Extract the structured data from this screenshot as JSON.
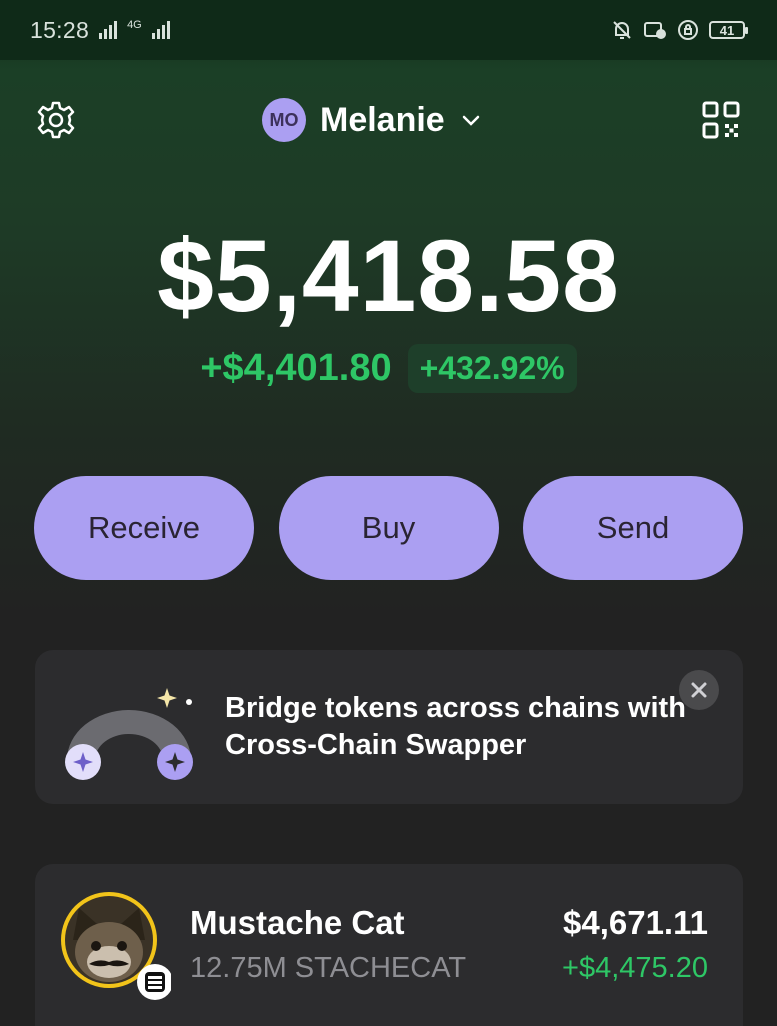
{
  "status_bar": {
    "time": "15:28",
    "network": "4G",
    "battery": "41"
  },
  "header": {
    "account_initials": "MO",
    "account_name": "Melanie",
    "icons": [
      "gear-icon",
      "chevron-down-icon",
      "qr-code-icon"
    ]
  },
  "portfolio": {
    "balance": "$5,418.58",
    "change_amount": "+$4,401.80",
    "change_percent": "+432.92%"
  },
  "actions": [
    {
      "label": "Receive"
    },
    {
      "label": "Buy"
    },
    {
      "label": "Send"
    }
  ],
  "promo": {
    "text": "Bridge tokens across chains with Cross-Chain Swapper",
    "icons": [
      "bridge-illustration-icon",
      "close-icon"
    ]
  },
  "tokens": [
    {
      "name": "Mustache Cat",
      "amount": "12.75M STACHECAT",
      "value": "$4,671.11",
      "change": "+$4,475.20"
    }
  ],
  "colors": {
    "accent": "#ab9ff2",
    "positive": "#2ec766",
    "card": "#2c2c2e",
    "background": "#222222",
    "header_green": "#1b3f26"
  }
}
